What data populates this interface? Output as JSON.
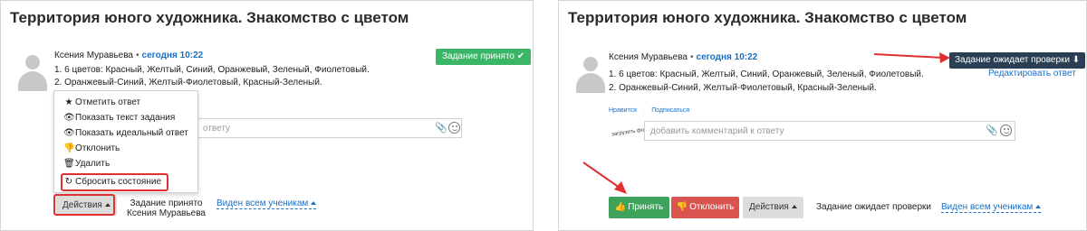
{
  "left": {
    "title": "Территория юного художника. Знакомство с цветом",
    "author": {
      "name": "Ксения Муравьева",
      "separator": "•",
      "time": "сегодня 10:22"
    },
    "answer_lines": [
      "1. 6 цветов: Красный, Желтый, Синий, Оранжевый, Зеленый, Фиолетовый.",
      "2. Оранжевый-Синий, Желтый-Фиолетовый, Красный-Зеленый."
    ],
    "status_badge": "Задание принято ✔",
    "menu_items": [
      {
        "icon": "★",
        "label": "Отметить ответ"
      },
      {
        "icon": "👁",
        "label": "Показать текст задания"
      },
      {
        "icon": "👁",
        "label": "Показать идеальный ответ"
      },
      {
        "icon": "👎",
        "label": "Отклонить"
      },
      {
        "icon": "🗑",
        "label": "Удалить"
      },
      {
        "icon": "↻",
        "label": "Сбросить состояние"
      }
    ],
    "comment_placeholder": "ответу",
    "actions_label": "Действия",
    "status_lines": [
      "Задание принято",
      "Ксения Муравьева"
    ],
    "visibility_label": "Виден всем ученикам"
  },
  "right": {
    "title": "Территория юного художника. Знакомство с цветом",
    "author": {
      "name": "Ксения Муравьева",
      "separator": "•",
      "time": "сегодня 10:22"
    },
    "answer_lines": [
      "1. 6 цветов: Красный, Желтый, Синий, Оранжевый, Зеленый, Фиолетовый.",
      "2. Оранжевый-Синий, Желтый-Фиолетовый, Красный-Зеленый."
    ],
    "status_badge": "Задание ожидает проверки ⬇",
    "edit_link": "Редактировать ответ",
    "like_link": "Нравится",
    "subscribe_link": "Подписаться",
    "link_separator": "·",
    "photo_placeholder": "загрузить фотографию",
    "comment_placeholder": "добавить комментарий к ответу",
    "accept_label": "Принять",
    "reject_label": "Отклонить",
    "actions_label": "Действия",
    "status_text": "Задание ожидает проверки",
    "visibility_label": "Виден всем ученикам"
  },
  "colors": {
    "accept_green": "#3ea25a",
    "badge_green": "#3bb566",
    "badge_dark": "#2a3f54",
    "reject_red": "#d9534f",
    "link_blue": "#1a6fc4",
    "highlight_red": "#e03131"
  }
}
